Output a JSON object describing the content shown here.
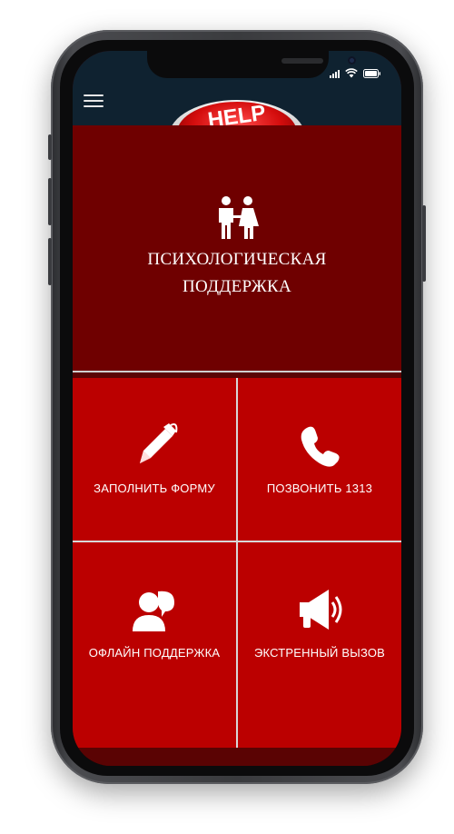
{
  "app": {
    "logo_text": "HELP",
    "hero_title": "ПСИХОЛОГИЧЕСКАЯ ПОДДЕРЖКА"
  },
  "tiles": [
    {
      "label": "ЗАПОЛНИТЬ ФОРМУ",
      "icon": "pen-icon"
    },
    {
      "label": "ПОЗВОНИТЬ 1313",
      "icon": "phone-icon"
    },
    {
      "label": "ОФЛАЙН ПОДДЕРЖКА",
      "icon": "chat-user-icon"
    },
    {
      "label": "ЭКСТРЕННЫЙ ВЫЗОВ",
      "icon": "megaphone-icon"
    }
  ],
  "colors": {
    "header": "#0f2230",
    "hero": "#6f0000",
    "tile": "#bb0000",
    "divider": "#d8d8d8"
  }
}
